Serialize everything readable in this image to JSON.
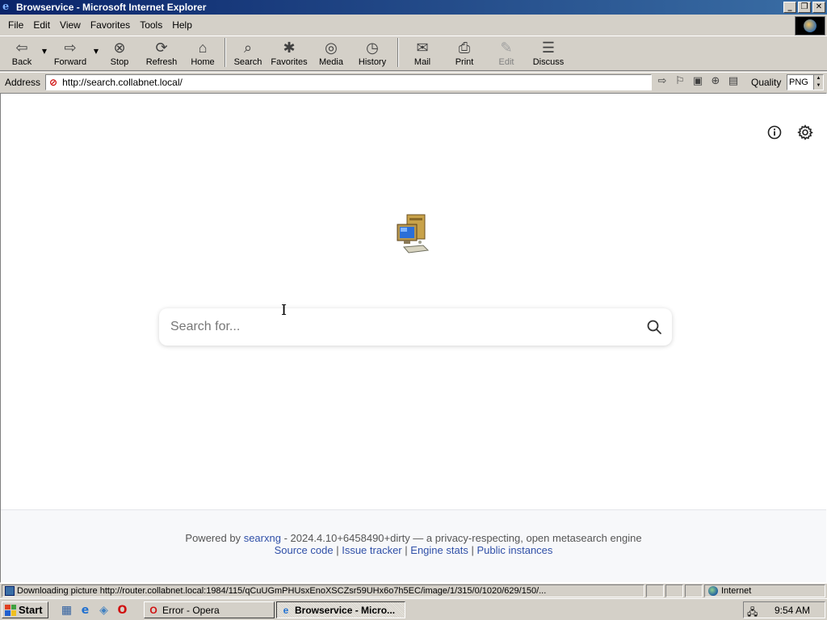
{
  "window": {
    "title": "Browservice - Microsoft Internet Explorer",
    "buttons": {
      "minimize": "_",
      "maximize": "❐",
      "close": "✕"
    }
  },
  "menu": [
    "File",
    "Edit",
    "View",
    "Favorites",
    "Tools",
    "Help"
  ],
  "toolbar": {
    "back": "Back",
    "forward": "Forward",
    "stop": "Stop",
    "refresh": "Refresh",
    "home": "Home",
    "search": "Search",
    "favorites": "Favorites",
    "media": "Media",
    "history": "History",
    "mail": "Mail",
    "print": "Print",
    "edit": "Edit",
    "discuss": "Discuss"
  },
  "address": {
    "label": "Address",
    "url": "http://search.collabnet.local/",
    "quality_label": "Quality",
    "quality_value": "PNG"
  },
  "page": {
    "search_placeholder": "Search for...",
    "footer": {
      "powered_by": "Powered by",
      "engine_link": "searxng",
      "version_text": "- 2024.4.10+6458490+dirty — a privacy-respecting, open metasearch engine",
      "links": [
        "Source code",
        "Issue tracker",
        "Engine stats",
        "Public instances"
      ],
      "separator": "|"
    }
  },
  "statusbar": {
    "text": "Downloading picture http://router.collabnet.local:1984/115/qCuUGmPHUsxEnoXSCZsr59UHx6o7h5EC/image/1/315/0/1020/629/150/...",
    "zone": "Internet"
  },
  "taskbar": {
    "start": "Start",
    "tasks": [
      "Error - Opera",
      "Browservice - Micro..."
    ],
    "clock": "9:54 AM"
  },
  "colors": {
    "title_gradient_start": "#0a246a",
    "title_gradient_end": "#3a6ea5",
    "chrome": "#d4d0c8",
    "link": "#3050a8"
  }
}
